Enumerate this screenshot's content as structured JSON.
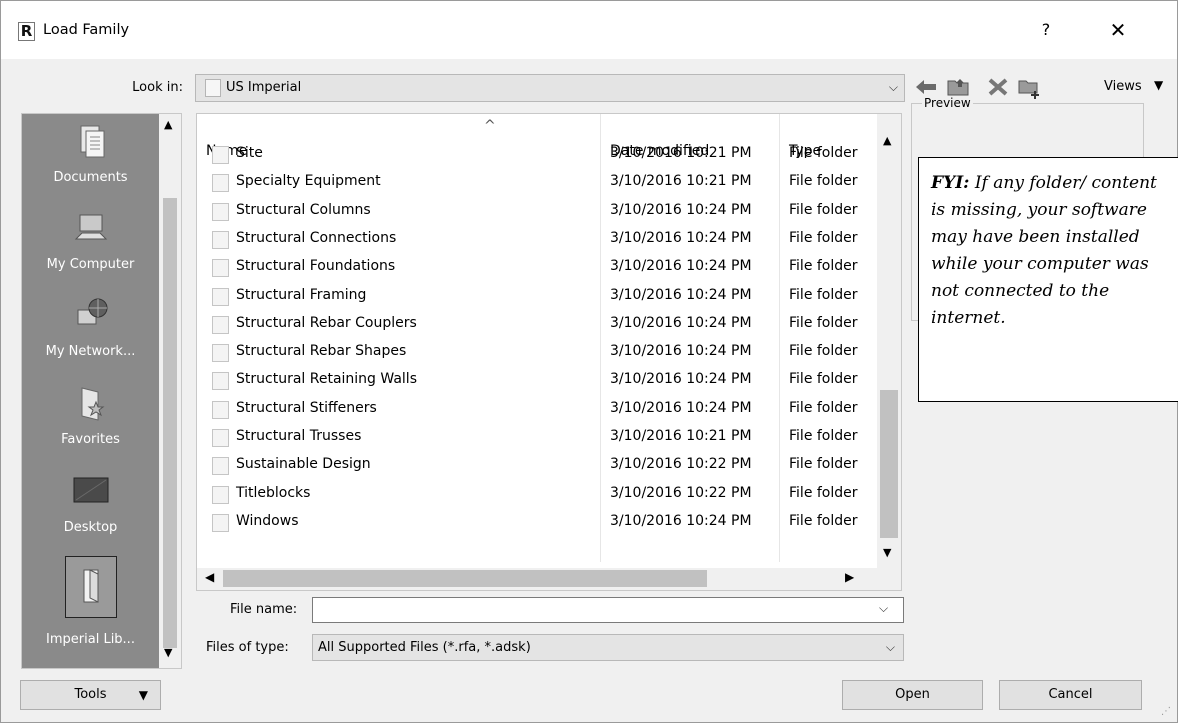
{
  "window": {
    "title": "Load Family",
    "help_glyph": "?",
    "close_glyph": "✕",
    "app_icon_letter": "R"
  },
  "lookin": {
    "label": "Look in:",
    "value": "US Imperial"
  },
  "toolbar": {
    "views_label": "Views"
  },
  "places": [
    {
      "label": "Documents"
    },
    {
      "label": "My Computer"
    },
    {
      "label": "My Network..."
    },
    {
      "label": "Favorites"
    },
    {
      "label": "Desktop"
    },
    {
      "label": "Imperial Lib..."
    }
  ],
  "columns": {
    "name": "Name",
    "date": "Date modified",
    "type": "Type"
  },
  "files": [
    {
      "name": "Site",
      "date": "3/10/2016 10:21 PM",
      "type": "File folder"
    },
    {
      "name": "Specialty Equipment",
      "date": "3/10/2016 10:21 PM",
      "type": "File folder"
    },
    {
      "name": "Structural Columns",
      "date": "3/10/2016 10:24 PM",
      "type": "File folder"
    },
    {
      "name": "Structural Connections",
      "date": "3/10/2016 10:24 PM",
      "type": "File folder"
    },
    {
      "name": "Structural Foundations",
      "date": "3/10/2016 10:24 PM",
      "type": "File folder"
    },
    {
      "name": "Structural Framing",
      "date": "3/10/2016 10:24 PM",
      "type": "File folder"
    },
    {
      "name": "Structural Rebar Couplers",
      "date": "3/10/2016 10:24 PM",
      "type": "File folder"
    },
    {
      "name": "Structural Rebar Shapes",
      "date": "3/10/2016 10:24 PM",
      "type": "File folder"
    },
    {
      "name": "Structural Retaining Walls",
      "date": "3/10/2016 10:24 PM",
      "type": "File folder"
    },
    {
      "name": "Structural Stiffeners",
      "date": "3/10/2016 10:24 PM",
      "type": "File folder"
    },
    {
      "name": "Structural Trusses",
      "date": "3/10/2016 10:21 PM",
      "type": "File folder"
    },
    {
      "name": "Sustainable Design",
      "date": "3/10/2016 10:22 PM",
      "type": "File folder"
    },
    {
      "name": "Titleblocks",
      "date": "3/10/2016 10:22 PM",
      "type": "File folder"
    },
    {
      "name": "Windows",
      "date": "3/10/2016 10:24 PM",
      "type": "File folder"
    }
  ],
  "filename": {
    "label": "File name:",
    "value": ""
  },
  "filetype": {
    "label": "Files of type:",
    "value": "All Supported Files  (*.rfa, *.adsk)"
  },
  "preview": {
    "label": "Preview"
  },
  "fyi": {
    "lead": "FYI:",
    "text": "If any folder/ content is missing, your software may have been installed while your computer was not connected to the internet."
  },
  "buttons": {
    "tools": "Tools",
    "open": "Open",
    "cancel": "Cancel"
  }
}
